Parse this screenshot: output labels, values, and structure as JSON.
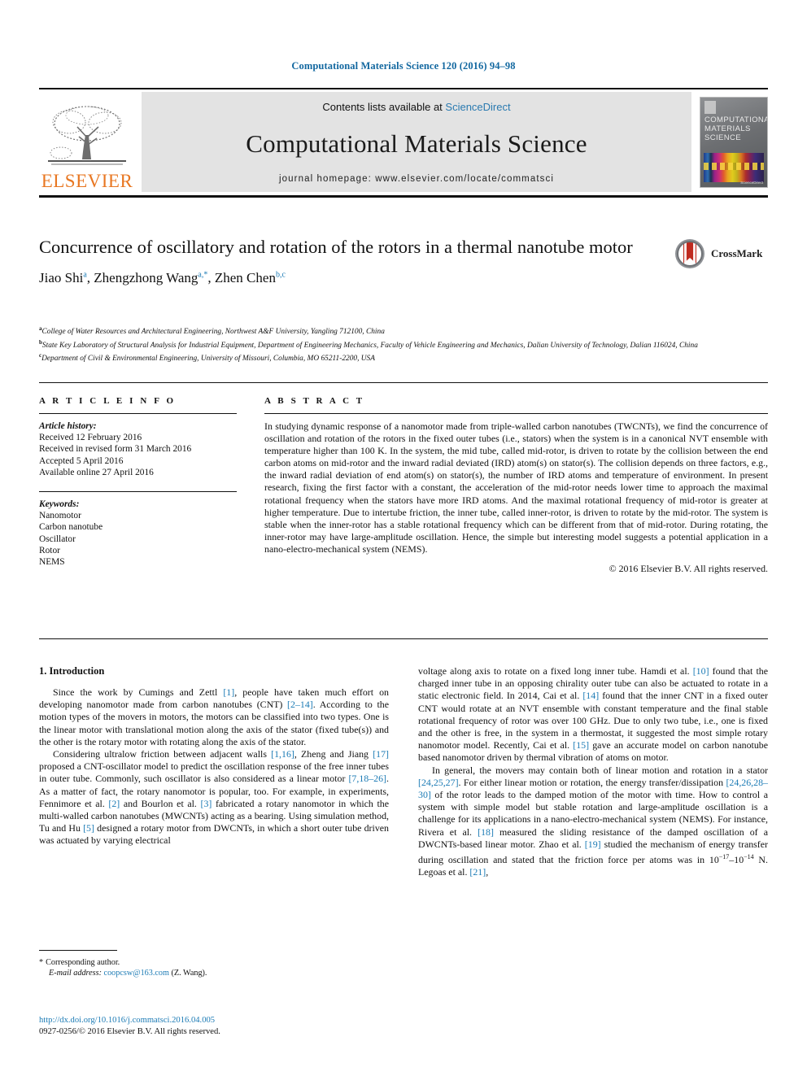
{
  "running_head": "Computational Materials Science 120 (2016) 94–98",
  "masthead": {
    "publisher_logo_text": "ELSEVIER",
    "contents_prefix": "Contents lists available at ",
    "contents_link": "ScienceDirect",
    "journal_title": "Computational Materials Science",
    "homepage": "journal homepage: www.elsevier.com/locate/commatsci",
    "cover": {
      "line1": "COMPUTATIONAL",
      "line2": "MATERIALS",
      "line3": "SCIENCE",
      "caption": "ScienceDirect"
    }
  },
  "article": {
    "title": "Concurrence of oscillatory and rotation of the rotors in a thermal nanotube motor",
    "authors": [
      {
        "name": "Jiao Shi",
        "marks": "a"
      },
      {
        "name": "Zhengzhong Wang",
        "marks": "a,*"
      },
      {
        "name": "Zhen Chen",
        "marks": "b,c"
      }
    ],
    "crossmark_label": "CrossMark",
    "affiliations": [
      {
        "mark": "a",
        "text": "College of Water Resources and Architectural Engineering, Northwest A&F University, Yangling 712100, China"
      },
      {
        "mark": "b",
        "text": "State Key Laboratory of Structural Analysis for Industrial Equipment, Department of Engineering Mechanics, Faculty of Vehicle Engineering and Mechanics, Dalian University of Technology, Dalian 116024, China"
      },
      {
        "mark": "c",
        "text": "Department of Civil & Environmental Engineering, University of Missouri, Columbia, MO 65211-2200, USA"
      }
    ]
  },
  "article_info": {
    "heading": "A R T I C L E    I N F O",
    "history_label": "Article history:",
    "history": [
      "Received 12 February 2016",
      "Received in revised form 31 March 2016",
      "Accepted 5 April 2016",
      "Available online 27 April 2016"
    ],
    "keywords_label": "Keywords:",
    "keywords": [
      "Nanomotor",
      "Carbon nanotube",
      "Oscillator",
      "Rotor",
      "NEMS"
    ]
  },
  "abstract": {
    "heading": "A B S T R A C T",
    "text": "In studying dynamic response of a nanomotor made from triple-walled carbon nanotubes (TWCNTs), we find the concurrence of oscillation and rotation of the rotors in the fixed outer tubes (i.e., stators) when the system is in a canonical NVT ensemble with temperature higher than 100 K. In the system, the mid tube, called mid-rotor, is driven to rotate by the collision between the end carbon atoms on mid-rotor and the inward radial deviated (IRD) atom(s) on stator(s). The collision depends on three factors, e.g., the inward radial deviation of end atom(s) on stator(s), the number of IRD atoms and temperature of environment. In present research, fixing the first factor with a constant, the acceleration of the mid-rotor needs lower time to approach the maximal rotational frequency when the stators have more IRD atoms. And the maximal rotational frequency of mid-rotor is greater at higher temperature. Due to intertube friction, the inner tube, called inner-rotor, is driven to rotate by the mid-rotor. The system is stable when the inner-rotor has a stable rotational frequency which can be different from that of mid-rotor. During rotating, the inner-rotor may have large-amplitude oscillation. Hence, the simple but interesting model suggests a potential application in a nano-electro-mechanical system (NEMS).",
    "copyright": "© 2016 Elsevier B.V. All rights reserved."
  },
  "body": {
    "section_title": "1. Introduction",
    "left_paragraphs": [
      "Since the work by Cumings and Zettl [1], people have taken much effort on developing nanomotor made from carbon nanotubes (CNT) [2–14]. According to the motion types of the movers in motors, the motors can be classified into two types. One is the linear motor with translational motion along the axis of the stator (fixed tube(s)) and the other is the rotary motor with rotating along the axis of the stator.",
      "Considering ultralow friction between adjacent walls [1,16], Zheng and Jiang [17] proposed a CNT-oscillator model to predict the oscillation response of the free inner tubes in outer tube. Commonly, such oscillator is also considered as a linear motor [7,18–26]. As a matter of fact, the rotary nanomotor is popular, too. For example, in experiments, Fennimore et al. [2] and Bourlon et al. [3] fabricated a rotary nanomotor in which the multi-walled carbon nanotubes (MWCNTs) acting as a bearing. Using simulation method, Tu and Hu [5] designed a rotary motor from DWCNTs, in which a short outer tube driven was actuated by varying electrical"
    ],
    "right_paragraphs": [
      "voltage along axis to rotate on a fixed long inner tube. Hamdi et al. [10] found that the charged inner tube in an opposing chirality outer tube can also be actuated to rotate in a static electronic field. In 2014, Cai et al. [14] found that the inner CNT in a fixed outer CNT would rotate at an NVT ensemble with constant temperature and the final stable rotational frequency of rotor was over 100 GHz. Due to only two tube, i.e., one is fixed and the other is free, in the system in a thermostat, it suggested the most simple rotary nanomotor model. Recently, Cai et al. [15] gave an accurate model on carbon nanotube based nanomotor driven by thermal vibration of atoms on motor.",
      "In general, the movers may contain both of linear motion and rotation in a stator [24,25,27]. For either linear motion or rotation, the energy transfer/dissipation [24,26,28–30] of the rotor leads to the damped motion of the motor with time. How to control a system with simple model but stable rotation and large-amplitude oscillation is a challenge for its applications in a nano-electro-mechanical system (NEMS). For instance, Rivera et al. [18] measured the sliding resistance of the damped oscillation of a DWCNTs-based linear motor. Zhao et al. [19] studied the mechanism of energy transfer during oscillation and stated that the friction force per atoms was in 10−17–10−14 N. Legoas et al. [21],"
    ]
  },
  "footnote": {
    "corresponding": "Corresponding author.",
    "email_label": "E-mail address:",
    "email": "coopcsw@163.com",
    "email_suffix": "(Z. Wang)."
  },
  "footer": {
    "doi": "http://dx.doi.org/10.1016/j.commatsci.2016.04.005",
    "issn_line": "0927-0256/© 2016 Elsevier B.V. All rights reserved."
  },
  "colors": {
    "accent_blue": "#1c7bb5",
    "head_blue": "#1368a0",
    "elsevier_orange": "#e87722",
    "band_gray": "#e3e3e3"
  }
}
